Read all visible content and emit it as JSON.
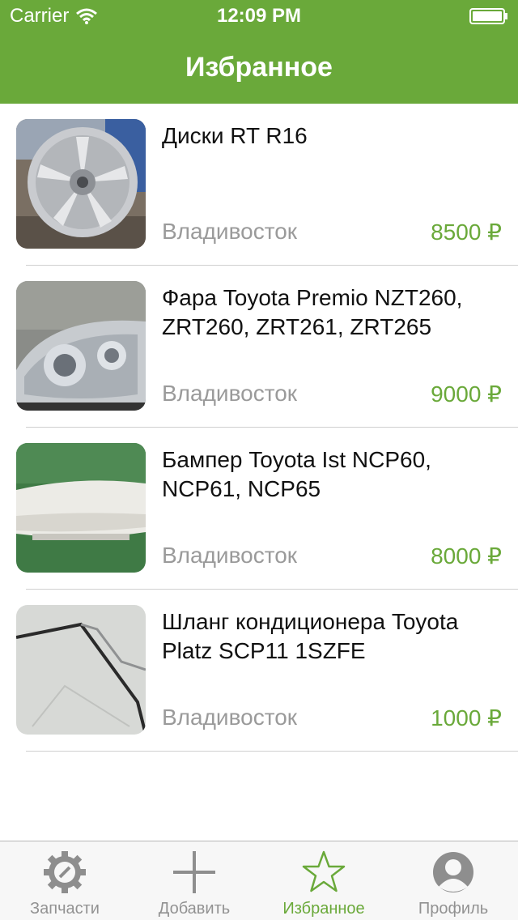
{
  "status_bar": {
    "carrier": "Carrier",
    "time": "12:09 PM"
  },
  "header": {
    "title": "Избранное"
  },
  "items": [
    {
      "title": "Диски RT R16",
      "city": "Владивосток",
      "price": "8500 ₽"
    },
    {
      "title": "Фара Toyota Premio NZT260, ZRT260, ZRT261, ZRT265",
      "city": "Владивосток",
      "price": "9000 ₽"
    },
    {
      "title": "Бампер Toyota Ist NCP60, NCP61, NCP65",
      "city": "Владивосток",
      "price": "8000 ₽"
    },
    {
      "title": "Шланг кондиционера Toyota Platz SCP11 1SZFE",
      "city": "Владивосток",
      "price": "1000 ₽"
    }
  ],
  "tabbar": {
    "tabs": [
      {
        "label": "Запчасти",
        "icon": "gear-icon"
      },
      {
        "label": "Добавить",
        "icon": "plus-icon"
      },
      {
        "label": "Избранное",
        "icon": "star-icon",
        "active": true
      },
      {
        "label": "Профиль",
        "icon": "profile-icon"
      }
    ]
  },
  "colors": {
    "accent": "#6aa93a",
    "secondary_text": "#9a9a9a",
    "tab_inactive": "#929292"
  }
}
